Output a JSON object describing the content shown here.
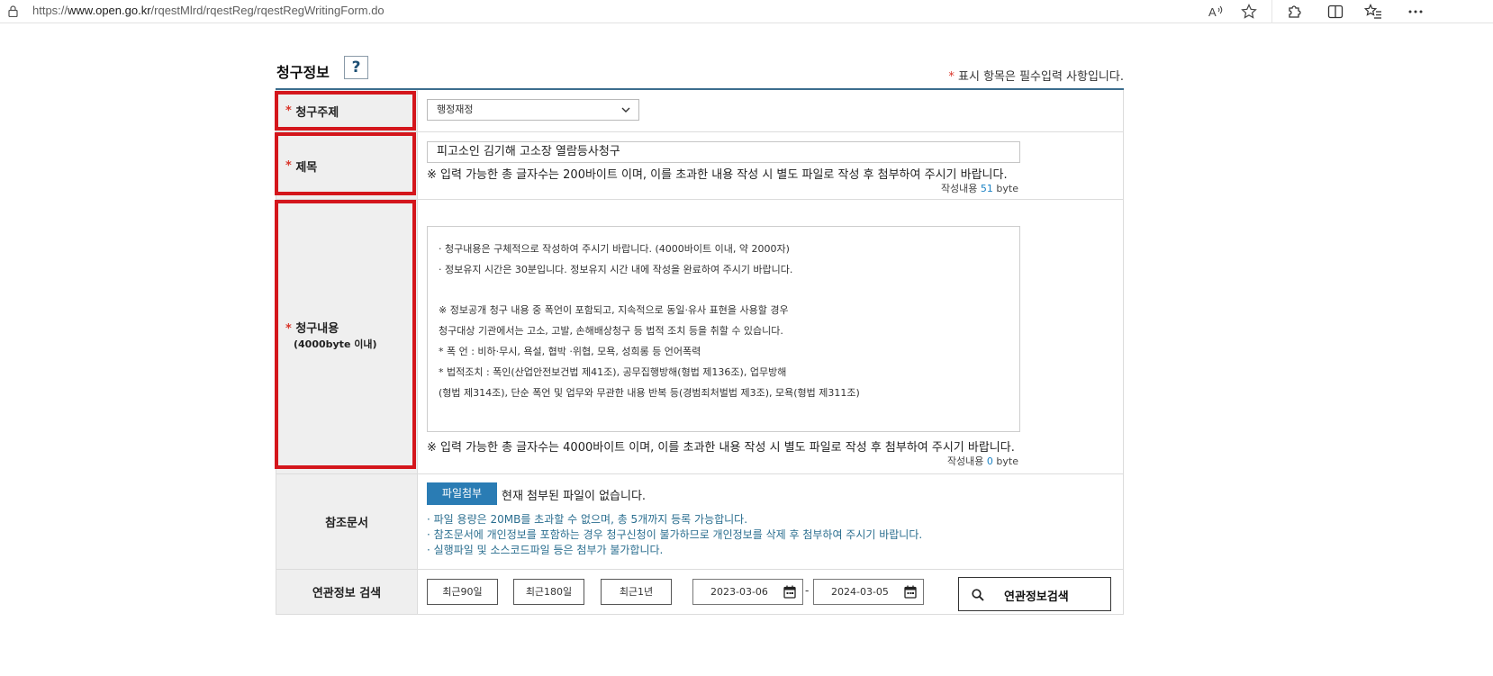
{
  "browser": {
    "url_prefix": "https://",
    "url_host": "www.open.go.kr",
    "url_path": "/rqestMlrd/rqestReg/rqestRegWritingForm.do",
    "toolbar_icons": [
      "read-aloud-icon",
      "favorite-star-icon",
      "extensions-icon",
      "split-screen-icon",
      "favorites-icon"
    ]
  },
  "section": {
    "title": "청구정보",
    "help_label": "?",
    "required_note": "표시 항목은 필수입력 사항입니다.",
    "required_mark": "*"
  },
  "rows": {
    "subject": {
      "label": "청구주제",
      "selected": "행정재정"
    },
    "title": {
      "label": "제목",
      "value": "피고소인 김기해 고소장 열람등사청구",
      "notice": "※ 입력 가능한 총 글자수는 200바이트 이며, 이를 초과한 내용 작성 시 별도 파일로 작성 후 첨부하여 주시기 바랍니다.",
      "count_prefix": "작성내용",
      "count": "51",
      "count_unit": "byte"
    },
    "content": {
      "label": "청구내용",
      "sublabel": "(4000byte 이내)",
      "placeholder_lines": [
        "· 청구내용은 구체적으로 작성하여 주시기 바랍니다. (4000바이트 이내, 약 2000자)",
        "· 정보유지 시간은 30분입니다. 정보유지 시간 내에 작성을 완료하여 주시기 바랍니다.",
        "",
        " ※ 정보공개 청구 내용 중 폭언이 포함되고, 지속적으로 동일·유사 표현을 사용할 경우",
        " 청구대상 기관에서는 고소, 고발, 손해배상청구 등 법적 조치 등을 취할 수 있습니다.",
        "* 폭       언 : 비하·무시, 욕설, 협박 ·위협, 모욕, 성희롱 등 언어폭력",
        "* 법적조치 : 폭인(산업안전보건법 제41조), 공무집행방해(형법 제136조), 업무방해",
        "(형법 제314조), 단순 폭언 및 업무와 무관한 내용 반복 등(경범죄처벌법 제3조), 모욕(형법 제311조)"
      ],
      "notice": "※ 입력 가능한 총 글자수는 4000바이트 이며, 이를 초과한 내용 작성 시 별도 파일로 작성 후 첨부하여 주시기 바랍니다.",
      "count_prefix": "작성내용",
      "count": "0",
      "count_unit": "byte"
    },
    "reference": {
      "label": "참조문서",
      "attach_button": "파일첨부",
      "attach_status": "현재 첨부된 파일이 없습니다.",
      "info": [
        "· 파일 용량은 20MB를 초과할 수 없으며, 총 5개까지 등록 가능합니다.",
        "· 참조문서에 개인정보를 포함하는 경우 청구신청이 불가하므로 개인정보를 삭제 후 첨부하여 주시기 바랍니다.",
        "· 실행파일 및 소스코드파일 등은 첨부가 불가합니다."
      ]
    },
    "related": {
      "label": "연관정보 검색",
      "period_buttons": [
        "최근90일",
        "최근180일",
        "최근1년"
      ],
      "date_from": "2023-03-06",
      "date_separator": "-",
      "date_to": "2024-03-05",
      "search_button": "연관정보검색"
    }
  },
  "colors": {
    "highlight_box": "#d4161c",
    "accent": "#2a7cb4",
    "required": "#d9362b",
    "table_top_border": "#3c6d8e"
  }
}
